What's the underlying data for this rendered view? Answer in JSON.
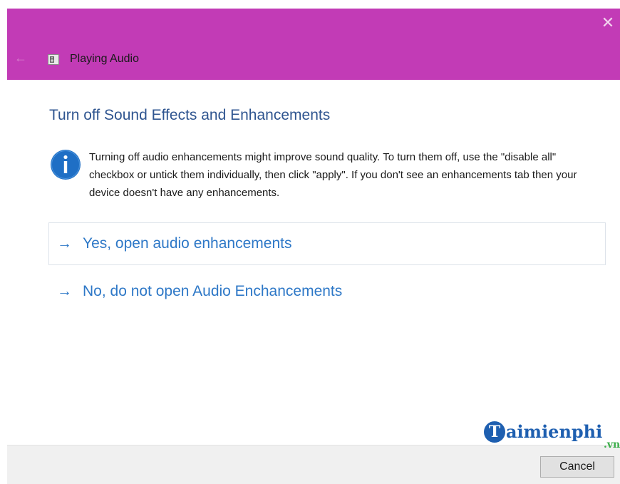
{
  "window": {
    "title": "Playing Audio",
    "accent_color": "#c23bb6",
    "back_icon": "back-arrow-icon",
    "close_icon": "close-icon",
    "close_glyph": "✕",
    "back_glyph": "←"
  },
  "content": {
    "heading": "Turn off Sound Effects and Enhancements",
    "info_icon": "info-icon",
    "info_text": "Turning off audio enhancements might improve sound quality. To turn them off, use the \"disable all\" checkbox or untick them individually, then click \"apply\". If you don't see an enhancements tab then your device doesn't have any enhancements.",
    "options": [
      {
        "arrow": "→",
        "label": "Yes, open audio enhancements"
      },
      {
        "arrow": "→",
        "label": "No, do not open Audio Enchancements"
      }
    ]
  },
  "watermark": {
    "initial": "T",
    "text": "aimienphi",
    "suffix": ".vn"
  },
  "footer": {
    "cancel_label": "Cancel"
  }
}
